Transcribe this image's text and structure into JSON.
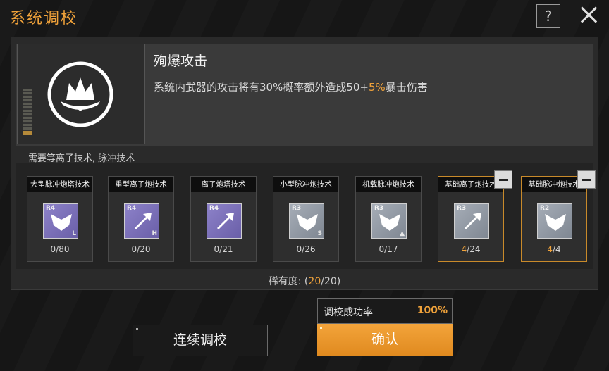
{
  "header": {
    "title": "系统调校",
    "help_label": "?"
  },
  "skill": {
    "name": "殉爆攻击",
    "desc_pre": "系统内武器的攻击将有30%概率额外造成50+",
    "desc_hl": "5%",
    "desc_post": "暴击伤害",
    "requirement": "需要等离子技术, 脉冲技术"
  },
  "cards": [
    {
      "title": "大型脉冲炮塔技术",
      "tier": "R4",
      "sub": "L",
      "count_owned": "0",
      "count_total": "/80",
      "color": "purple",
      "shape": "pulse",
      "gold": false,
      "minus": false
    },
    {
      "title": "重型离子炮技术",
      "tier": "R4",
      "sub": "H",
      "count_owned": "0",
      "count_total": "/20",
      "color": "purple",
      "shape": "ion",
      "gold": false,
      "minus": false
    },
    {
      "title": "离子炮塔技术",
      "tier": "R4",
      "sub": "",
      "count_owned": "0",
      "count_total": "/21",
      "color": "purple",
      "shape": "ion",
      "gold": false,
      "minus": false
    },
    {
      "title": "小型脉冲炮技术",
      "tier": "R3",
      "sub": "S",
      "count_owned": "0",
      "count_total": "/26",
      "color": "gray",
      "shape": "pulse",
      "gold": false,
      "minus": false
    },
    {
      "title": "机载脉冲炮技术",
      "tier": "R3",
      "sub": "▲",
      "count_owned": "0",
      "count_total": "/17",
      "color": "gray",
      "shape": "pulse",
      "gold": false,
      "minus": false
    },
    {
      "title": "基础离子炮技术",
      "tier": "R3",
      "sub": "",
      "count_owned": "4",
      "count_total": "/24",
      "color": "gray",
      "shape": "ion",
      "gold": true,
      "minus": true
    },
    {
      "title": "基础脉冲炮技术",
      "tier": "R2",
      "sub": "",
      "count_owned": "4",
      "count_total": "/4",
      "color": "gray",
      "shape": "pulse",
      "gold": true,
      "minus": true
    }
  ],
  "rarity": {
    "label": "稀有度: (",
    "current": "20",
    "total": "/20)"
  },
  "success_rate": {
    "label": "调校成功率",
    "value": "100%"
  },
  "buttons": {
    "continue_label": "连续调校",
    "confirm_label": "确认"
  },
  "colors": {
    "accent": "#f0a23a",
    "tier_purple": "#7b70b8",
    "tier_gray": "#939aa4"
  }
}
